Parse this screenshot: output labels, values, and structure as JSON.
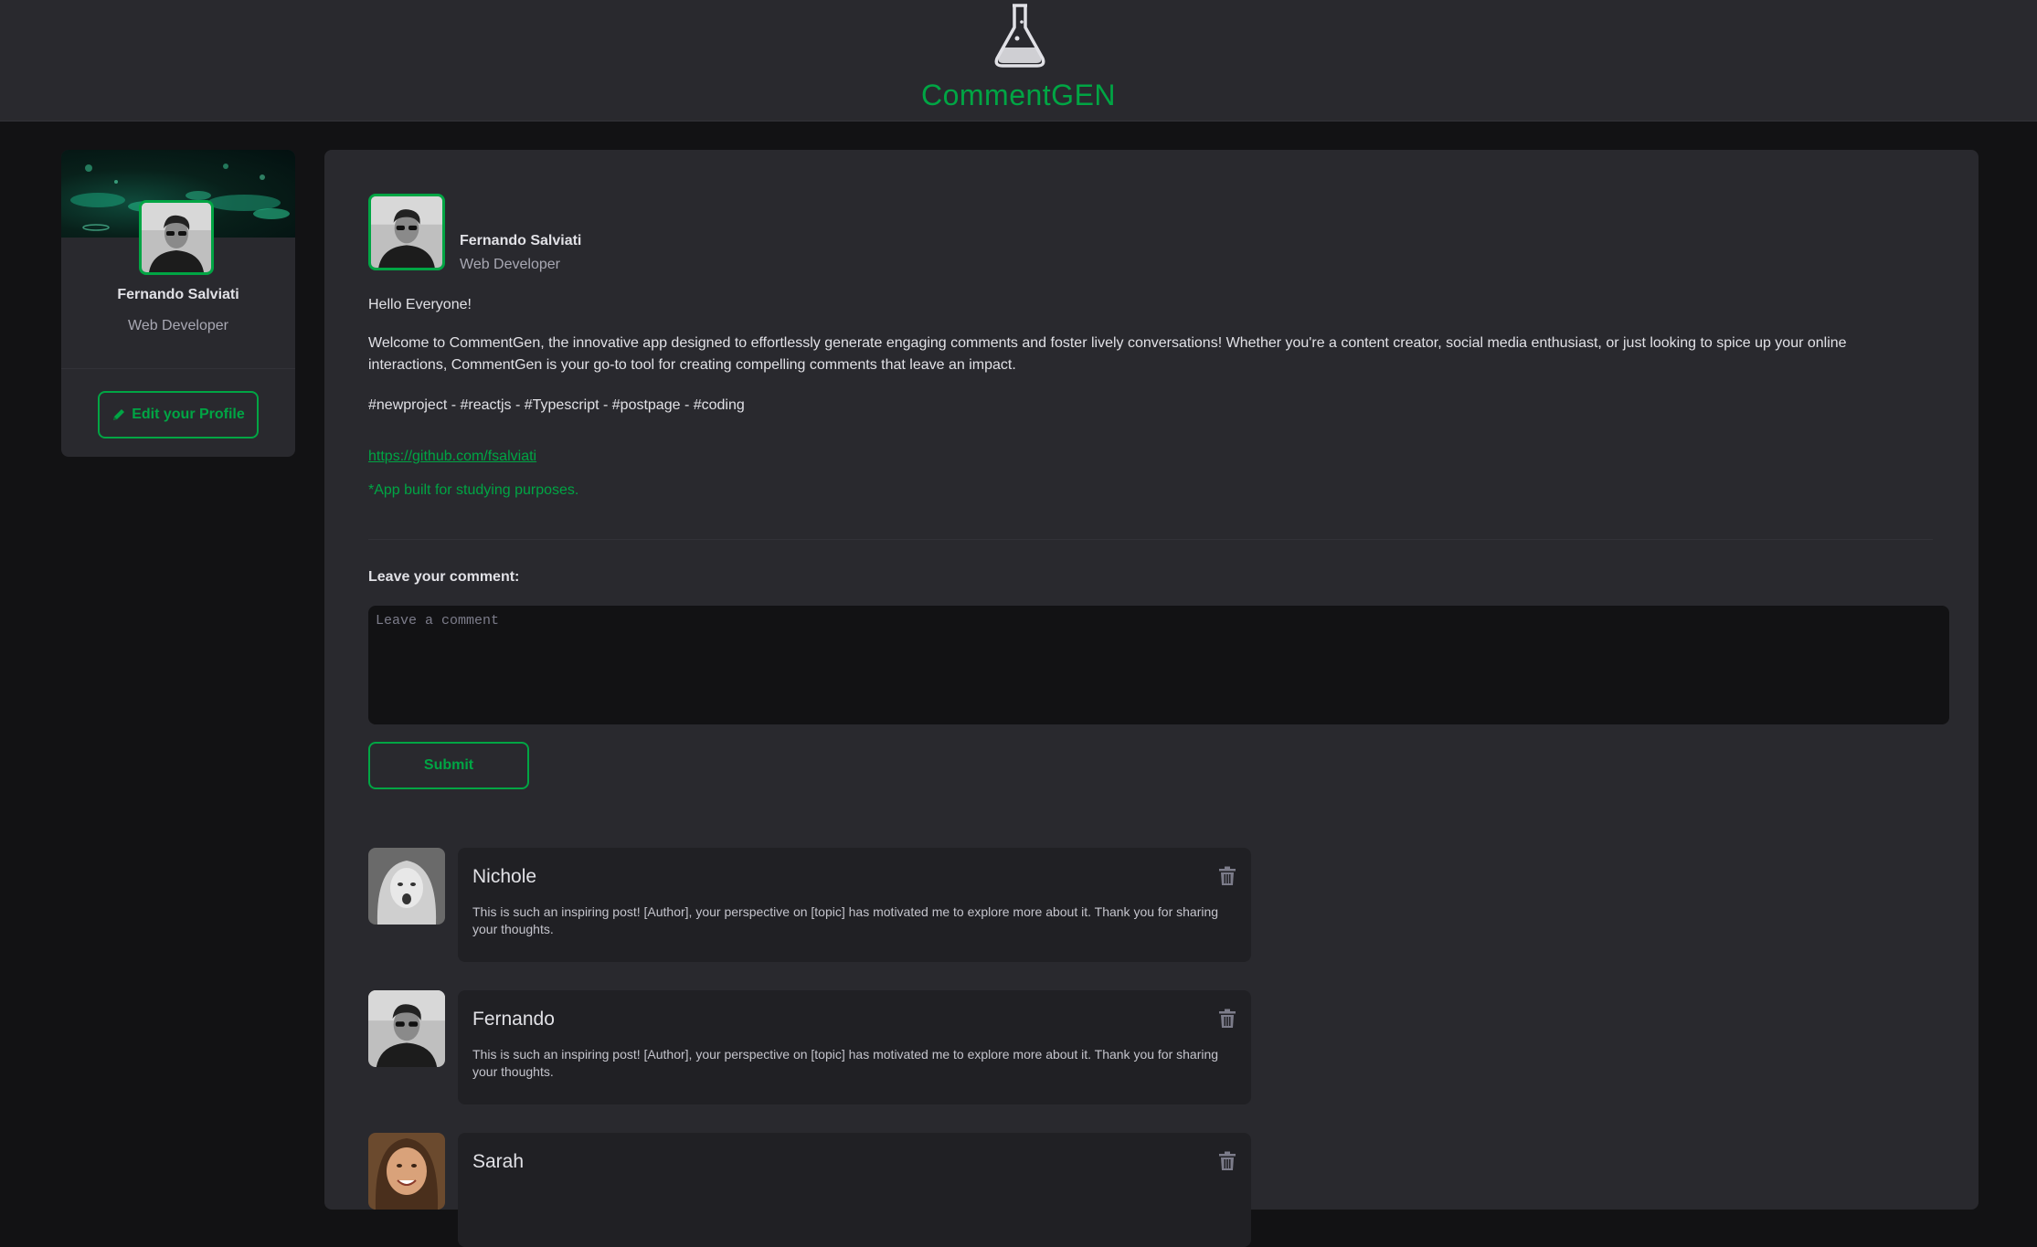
{
  "header": {
    "logo_icon": "flask-icon",
    "title": "CommentGEN"
  },
  "sidebar": {
    "name": "Fernando Salviati",
    "role": "Web Developer",
    "edit_icon": "pencil-icon",
    "edit_label": "Edit your Profile"
  },
  "post": {
    "author_name": "Fernando Salviati",
    "author_role": "Web Developer",
    "greeting": "Hello Everyone!",
    "body": "Welcome to CommentGen, the innovative app designed to effortlessly generate engaging comments and foster lively conversations! Whether you're a content creator, social media enthusiast, or just looking to spice up your online interactions, CommentGen is your go-to tool for creating compelling comments that leave an impact.",
    "hashtags": "#newproject - #reactjs - #Typescript - #postpage - #coding",
    "link": "https://github.com/fsalviati",
    "note": "*App built for studying purposes."
  },
  "comment_form": {
    "label": "Leave your comment:",
    "placeholder": "Leave a comment",
    "submit_label": "Submit"
  },
  "comments": [
    {
      "name": "Nichole",
      "text": "This is such an inspiring post! [Author], your perspective on [topic] has motivated me to explore more about it. Thank you for sharing your thoughts."
    },
    {
      "name": "Fernando",
      "text": "This is such an inspiring post! [Author], your perspective on [topic] has motivated me to explore more about it. Thank you for sharing your thoughts."
    },
    {
      "name": "Sarah",
      "text": ""
    }
  ],
  "colors": {
    "accent": "#00a544",
    "background": "#121214",
    "surface": "#29292e",
    "comment_box": "#202024"
  }
}
